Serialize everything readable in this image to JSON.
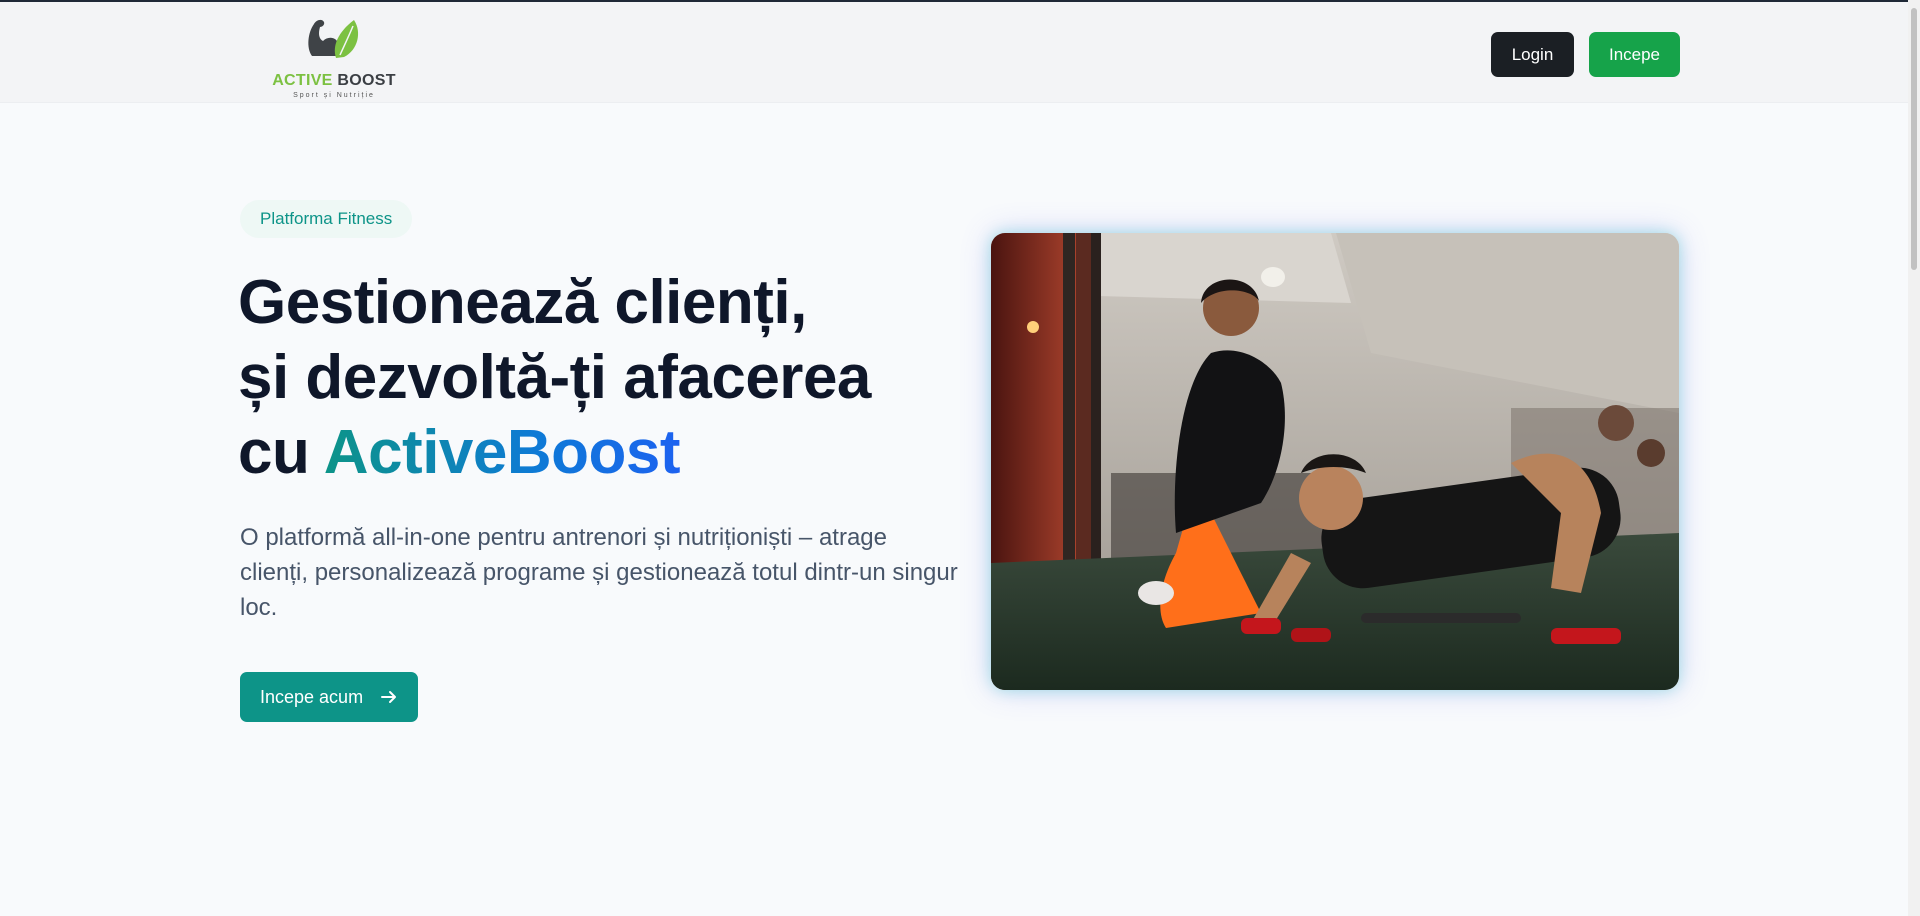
{
  "brand": {
    "name_accent": "ACTIVE",
    "name_main": "BOOST",
    "tagline": "Sport și Nutriție",
    "accent_color": "#7cc142"
  },
  "nav": {
    "login_label": "Login",
    "start_label": "Incepe"
  },
  "hero": {
    "badge": "Platforma Fitness",
    "headline_line1": "Gestionează clienți,",
    "headline_line2": "și dezvoltă-ți afacerea",
    "headline_line3_prefix": "cu",
    "headline_brand": "ActiveBoost",
    "description": "O platformă all-in-one pentru antrenori și nutriționiști – atrage clienți, personalizează programe și gestionează totul dintr-un singur loc.",
    "cta_label": "Incepe acum",
    "cta_icon": "arrow-right-icon",
    "photo_subject": "trainer-assisting-client-pushups"
  },
  "colors": {
    "primary": "#0d9488",
    "start_button": "#16a34a",
    "login_button": "#1b1f24",
    "heading": "#0f172a",
    "text": "#475569",
    "background": "#f8fafc"
  }
}
